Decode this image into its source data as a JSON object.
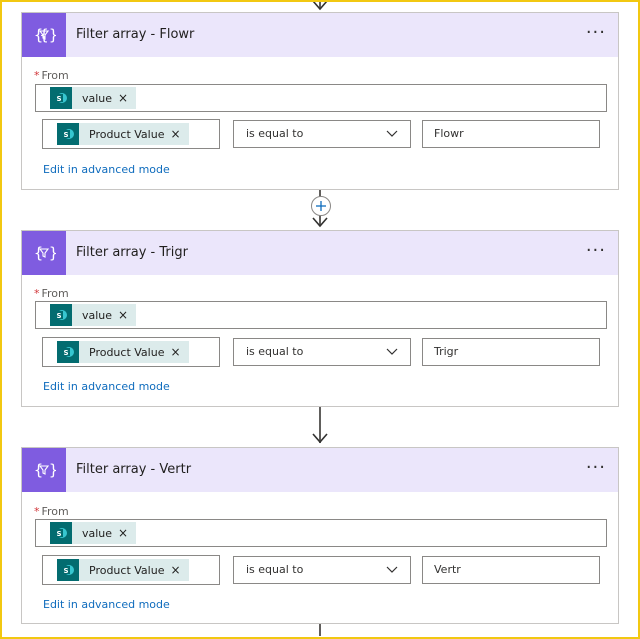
{
  "cards": [
    {
      "title": "Filter array - Flowr",
      "menu": "···",
      "from_label": "From",
      "required_mark": "*",
      "from_token": "value",
      "condition_token": "Product Value",
      "token_remove": "×",
      "operator": "is equal to",
      "compare_value": "Flowr",
      "advanced_link": "Edit in advanced mode"
    },
    {
      "title": "Filter array - Trigr",
      "menu": "···",
      "from_label": "From",
      "required_mark": "*",
      "from_token": "value",
      "condition_token": "Product Value",
      "token_remove": "×",
      "operator": "is equal to",
      "compare_value": "Trigr",
      "advanced_link": "Edit in advanced mode"
    },
    {
      "title": "Filter array - Vertr",
      "menu": "···",
      "from_label": "From",
      "required_mark": "*",
      "from_token": "value",
      "condition_token": "Product Value",
      "token_remove": "×",
      "operator": "is equal to",
      "compare_value": "Vertr",
      "advanced_link": "Edit in advanced mode"
    }
  ],
  "icons": {
    "card_icon": "filter-array-icon",
    "token_icon": "sharepoint-icon",
    "add_step": "plus-icon"
  },
  "colors": {
    "card_icon_bg": "#7f5ce0",
    "card_header_bg": "#ebe6fb",
    "token_icon_bg": "#036c70",
    "token_bg": "#dcebeb",
    "link": "#0f6cbd",
    "required": "#d13438",
    "frame": "#f2c811"
  }
}
